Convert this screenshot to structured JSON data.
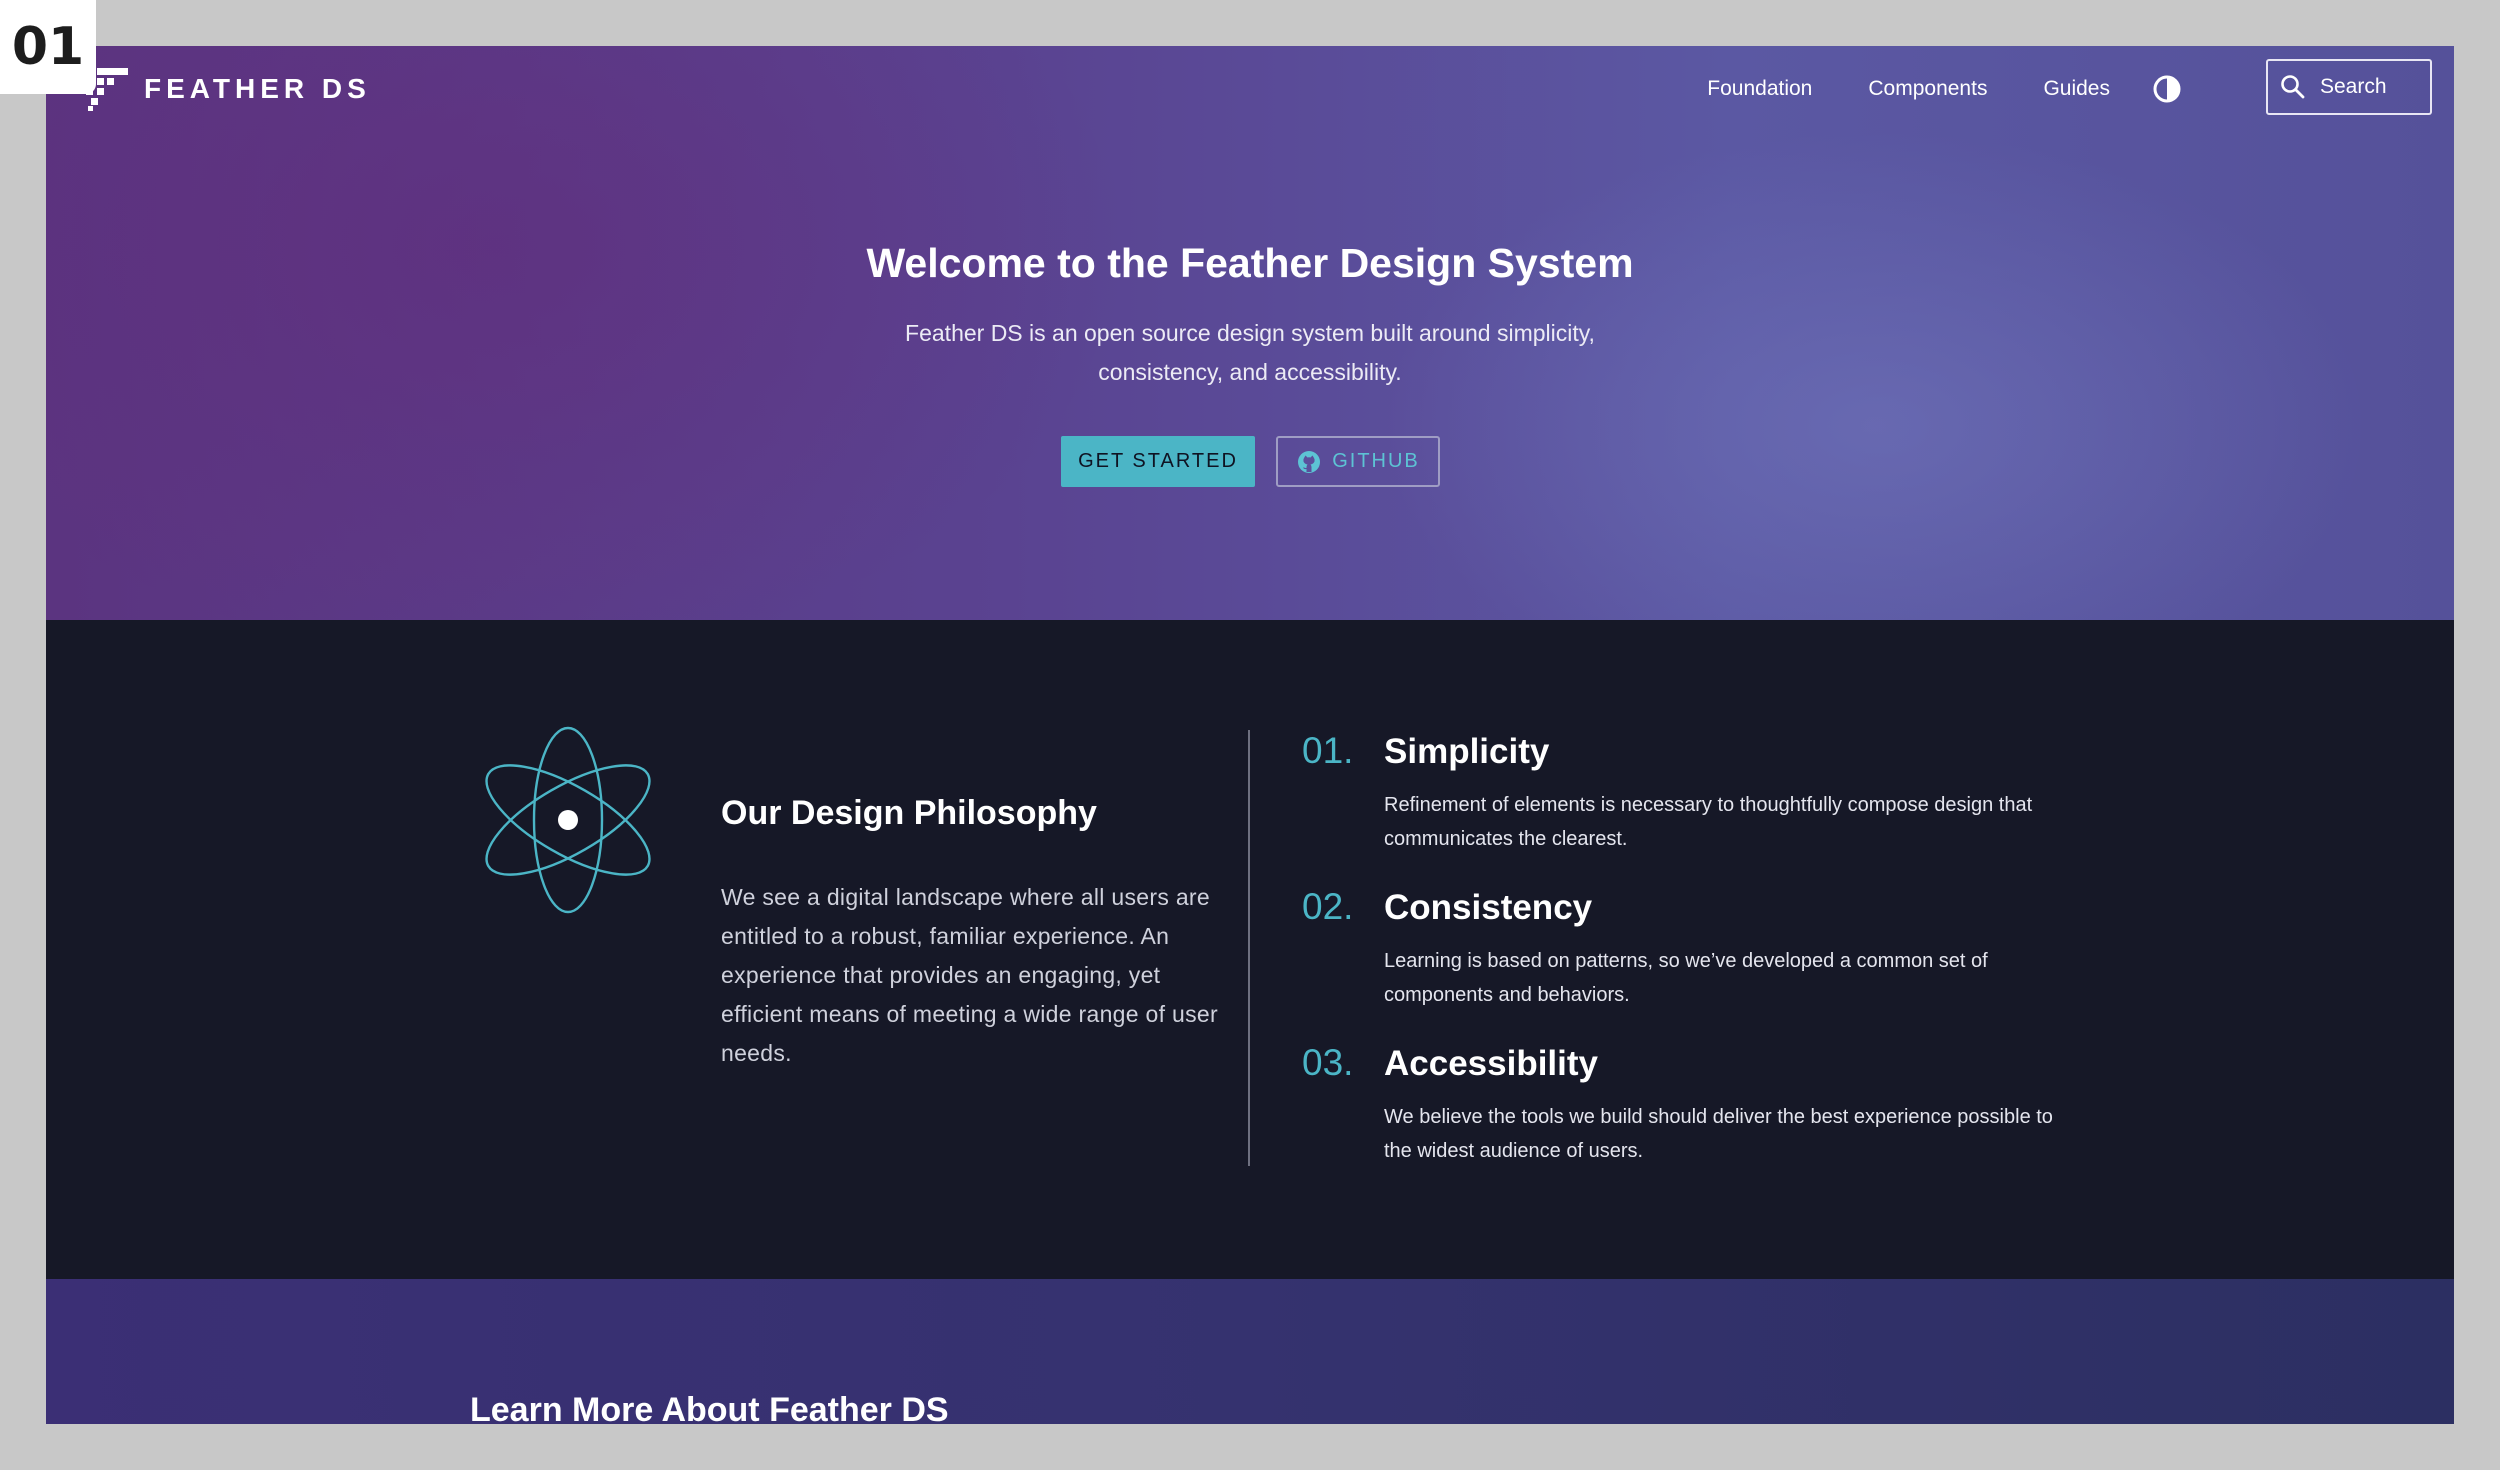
{
  "frame": {
    "label": "01"
  },
  "brand": {
    "name": "FEATHER DS"
  },
  "nav": {
    "links": [
      {
        "label": "Foundation"
      },
      {
        "label": "Components"
      },
      {
        "label": "Guides"
      }
    ],
    "theme_toggle_icon": "contrast-icon",
    "search": {
      "label": "Search",
      "icon": "search-icon"
    }
  },
  "hero": {
    "title": "Welcome to the Feather Design System",
    "subtitle": "Feather DS is an open source design system built around simplicity, consistency, and accessibility.",
    "primary_button": "GET STARTED",
    "secondary_button": "GITHUB",
    "secondary_icon": "github-icon"
  },
  "philosophy": {
    "icon": "atom-icon",
    "title": "Our Design Philosophy",
    "text": "We see a digital landscape where all users are entitled to a robust, familiar experience. An experience that provides an engaging, yet efficient means of meeting a wide range of user needs.",
    "principles": [
      {
        "number": "01.",
        "title": "Simplicity",
        "text": "Refinement of elements is necessary to thoughtfully compose design that communicates the clearest."
      },
      {
        "number": "02.",
        "title": "Consistency",
        "text": "Learning is based on patterns, so we’ve developed a common set of components and behaviors."
      },
      {
        "number": "03.",
        "title": "Accessibility",
        "text": "We believe the tools we build should deliver the best experience possible to the widest audience of users."
      }
    ]
  },
  "learn_more": {
    "title": "Learn More About Feather DS"
  },
  "colors": {
    "accent": "#4bb5c6",
    "dark_bg": "#161827",
    "hero_purple": "#5a4391"
  }
}
